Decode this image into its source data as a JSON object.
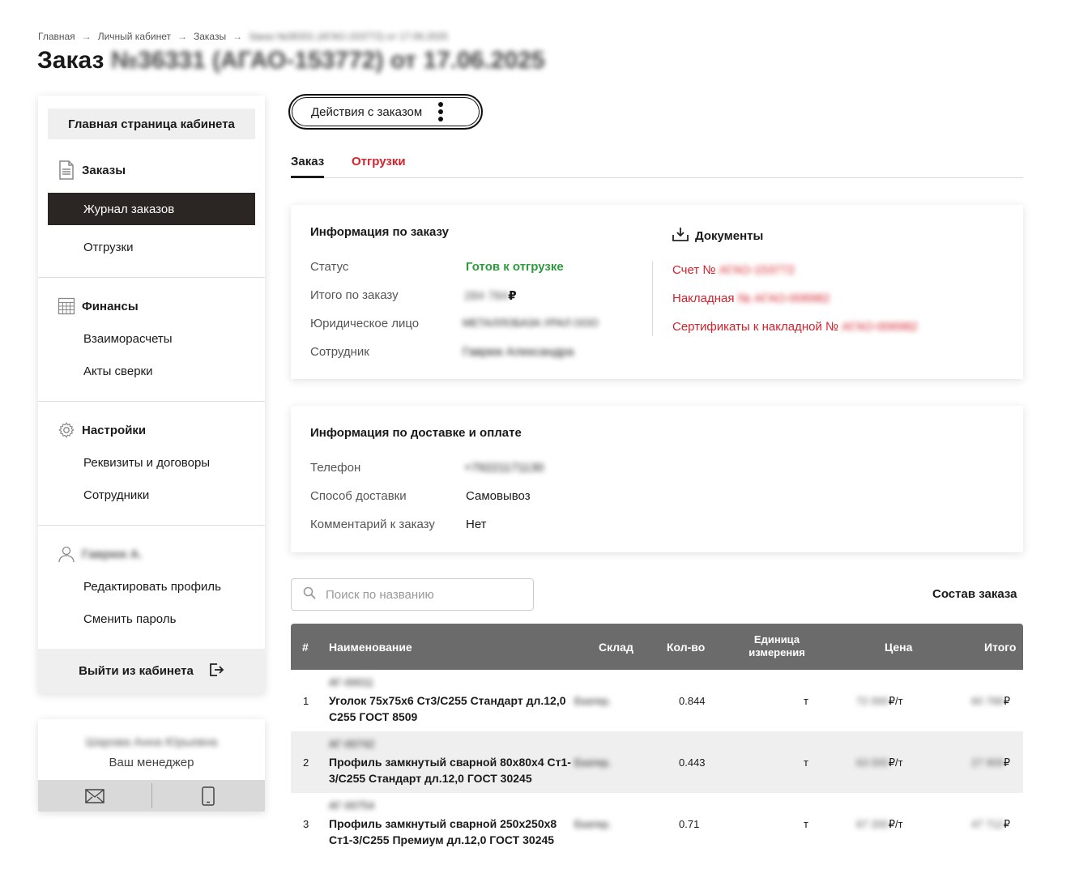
{
  "breadcrumb": {
    "items": [
      "Главная",
      "Личный кабинет",
      "Заказы"
    ],
    "current": "Заказ №36331 (АГАО-153772) от 17.06.2025",
    "separator": "→"
  },
  "page": {
    "title_prefix": "Заказ",
    "title_rest": "№36331 (АГАО-153772) от 17.06.2025"
  },
  "sidebar": {
    "home": "Главная страница кабинета",
    "orders": {
      "title": "Заказы",
      "icon": "document-icon",
      "items": [
        "Журнал заказов",
        "Отгрузки"
      ]
    },
    "finance": {
      "title": "Финансы",
      "icon": "calculator-icon",
      "items": [
        "Взаиморасчеты",
        "Акты сверки"
      ]
    },
    "settings": {
      "title": "Настройки",
      "icon": "gear-icon",
      "items": [
        "Реквизиты и договоры",
        "Сотрудники"
      ]
    },
    "profile": {
      "title": "Гаврюк А.",
      "icon": "user-icon",
      "items": [
        "Редактировать профиль",
        "Сменить пароль"
      ]
    },
    "logout": "Выйти из кабинета"
  },
  "manager": {
    "name": "Шарова Анна Юрьевна",
    "role": "Ваш менеджер",
    "contacts": [
      "mail-icon",
      "phone-icon"
    ]
  },
  "actions": {
    "label": "Действия с заказом"
  },
  "tabs": [
    "Заказ",
    "Отгрузки"
  ],
  "order_info": {
    "title": "Информация по заказу",
    "rows": [
      {
        "label": "Статус",
        "value": "Готов к отгрузке"
      },
      {
        "label": "Итого по заказу",
        "value": "284 784",
        "currency": "₽"
      },
      {
        "label": "Юридическое лицо",
        "value": "МЕТАЛЛОБАЗА УРАЛ ООО"
      },
      {
        "label": "Сотрудник",
        "value": "Гаврюк Александра"
      }
    ]
  },
  "documents": {
    "title": "Документы",
    "links": [
      {
        "label": "Счет №",
        "number": "АГАО-153772"
      },
      {
        "label": "Накладная",
        "number": "№ АГАО-006982"
      },
      {
        "label": "Сертификаты к накладной №",
        "number": "АГАО-006982"
      }
    ]
  },
  "delivery": {
    "title": "Информация по доставке и оплате",
    "rows": [
      {
        "label": "Телефон",
        "value": "+79221171130"
      },
      {
        "label": "Способ доставки",
        "value": "Самовывоз"
      },
      {
        "label": "Комментарий к заказу",
        "value": "Нет"
      }
    ]
  },
  "search": {
    "placeholder": "Поиск по названию"
  },
  "composition_title": "Состав заказа",
  "table": {
    "headers": [
      "#",
      "Наименование",
      "Склад",
      "Кол-во",
      "Единица измерения",
      "Цена",
      "Итого"
    ],
    "rows": [
      {
        "num": "1",
        "code": "АГ-00011",
        "name": "Уголок 75х75х6 Ст3/С255 Стандарт дл.12,0 С255 ГОСТ 8509",
        "stock": "Екатер.",
        "qty": "0.844",
        "unit": "т",
        "price": "72 000",
        "price_unit": "₽/т",
        "total": "60 768",
        "total_cur": "₽"
      },
      {
        "num": "2",
        "code": "АГ-00742",
        "name": "Профиль замкнутый сварной 80х80х4 Ст1-3/С255 Стандарт дл.12,0 ГОСТ 30245",
        "stock": "Екатер.",
        "qty": "0.443",
        "unit": "т",
        "price": "63 000",
        "price_unit": "₽/т",
        "total": "27 909",
        "total_cur": "₽"
      },
      {
        "num": "3",
        "code": "АГ-00754",
        "name": "Профиль замкнутый сварной 250х250х8 Ст1-3/С255 Премиум дл.12,0 ГОСТ 30245",
        "stock": "Екатер.",
        "qty": "0.71",
        "unit": "т",
        "price": "67 200",
        "price_unit": "₽/т",
        "total": "47 712",
        "total_cur": "₽"
      }
    ]
  },
  "colors": {
    "accent_red": "#d4222c",
    "status_green": "#2e9a3c",
    "dark": "#2b2523",
    "table_header": "#6b6b6b"
  }
}
